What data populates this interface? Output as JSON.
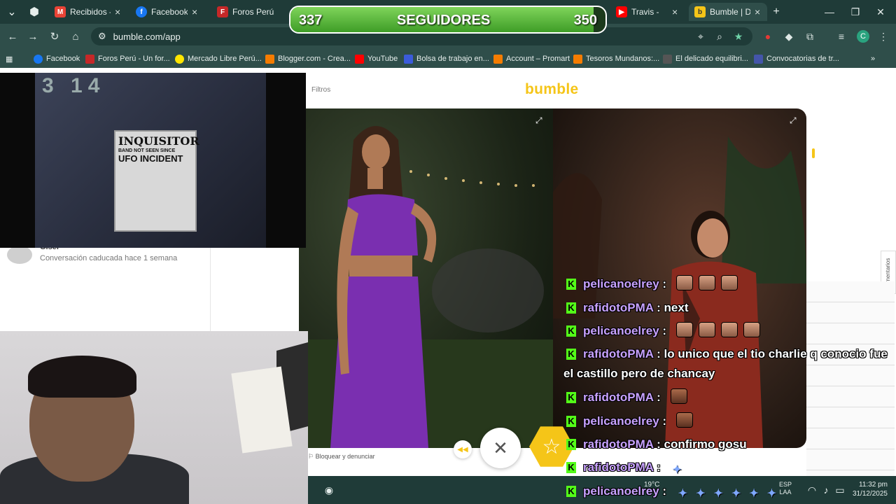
{
  "tabs": [
    {
      "title": "Recibidos -",
      "favicon_color": "#ea4335"
    },
    {
      "title": "Facebook",
      "favicon_color": "#1877f2"
    },
    {
      "title": "Foros Perú",
      "favicon_color": "#c62828"
    },
    {
      "title": "Travis -",
      "favicon_color": "#ff0000"
    },
    {
      "title": "Bumble | Da",
      "favicon_color": "#f5c518",
      "active": true
    }
  ],
  "followers": {
    "current": "337",
    "label": "SEGUIDORES",
    "goal": "350",
    "progress": 0.963
  },
  "address_bar": {
    "url": "bumble.com/app"
  },
  "profile_letter": "C",
  "bookmarks": [
    {
      "label": "Facebook",
      "color": "#1877f2"
    },
    {
      "label": "Foros Perú - Un for...",
      "color": "#c62828"
    },
    {
      "label": "Mercado Libre Perú...",
      "color": "#ffe600"
    },
    {
      "label": "Blogger.com - Crea...",
      "color": "#f57c00"
    },
    {
      "label": "YouTube",
      "color": "#ff0000"
    },
    {
      "label": "Bolsa de trabajo en...",
      "color": "#3b5bdb"
    },
    {
      "label": "Account – Promart",
      "color": "#f57c00"
    },
    {
      "label": "Tesoros Mundanos:...",
      "color": "#f57c00"
    },
    {
      "label": "El delicado equilibri...",
      "color": "#555555"
    },
    {
      "label": "Convocatorias de tr...",
      "color": "#4455aa"
    }
  ],
  "bumble": {
    "brand": "bumble",
    "filters_label": "Filtros",
    "conversation": {
      "name": "Gisel",
      "status": "Conversación caducada hace 1 semana"
    },
    "block_report_label": "Bloquear y denunciar",
    "comments_label": "Comentarios",
    "accent_color": "#f5c518"
  },
  "webcam_poster": {
    "headline": "INQUISITOR",
    "sub": "BAND NOT SEEN SINCE",
    "title": "UFO INCIDENT",
    "clock": "3 14"
  },
  "taskbar": {
    "temperature": "19°C",
    "lang_line1": "ESP",
    "lang_line2": "LAA",
    "time": "11:32 pm",
    "date": "31/12/2025"
  },
  "chat": [
    {
      "user": "pelicanoelrey",
      "text": "",
      "emotes": 3,
      "emote_style": "face"
    },
    {
      "user": "rafidotoPMA",
      "text": "next",
      "emotes": 0
    },
    {
      "user": "pelicanoelrey",
      "text": "",
      "emotes": 4,
      "emote_style": "face"
    },
    {
      "user": "rafidotoPMA",
      "text": "lo unico que el tio charlie q conocio fue el castillo pero de chancay",
      "emotes": 0
    },
    {
      "user": "rafidotoPMA",
      "text": "",
      "emotes": 1,
      "emote_style": "small"
    },
    {
      "user": "pelicanoelrey",
      "text": "",
      "emotes": 1,
      "emote_style": "small"
    },
    {
      "user": "rafidotoPMA",
      "text": "confirmo gosu",
      "emotes": 0
    },
    {
      "user": "rafidotoPMA",
      "text": "",
      "emotes": 1,
      "emote_style": "blue"
    },
    {
      "user": "pelicanoelrey",
      "text": "",
      "emotes": 6,
      "emote_style": "blue"
    }
  ]
}
